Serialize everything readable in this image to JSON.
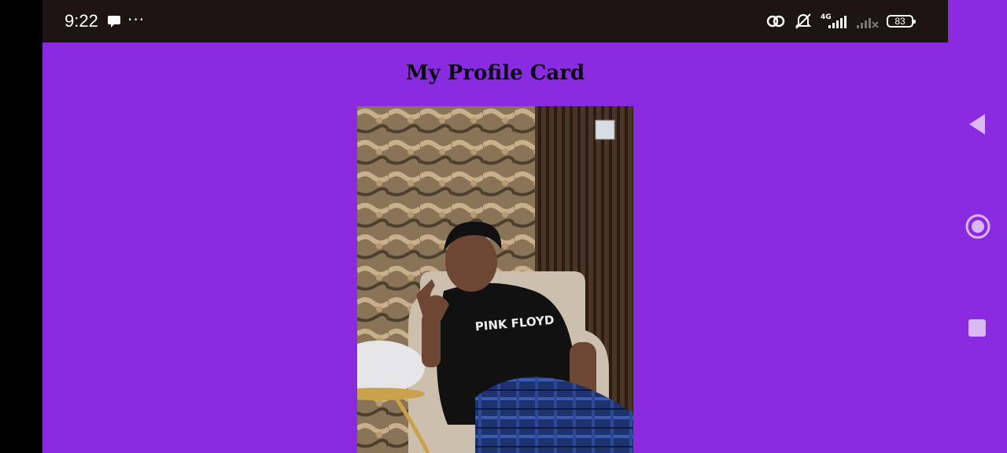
{
  "status_bar": {
    "time": "9:22",
    "network_label": "4G",
    "battery_level": "83",
    "icons": [
      "chat-bubble-icon",
      "more-dots-icon",
      "link-icon",
      "mute-icon",
      "signal-4g-icon",
      "signal-no-service-icon",
      "battery-icon"
    ]
  },
  "app": {
    "title": "My Profile Card",
    "photo": {
      "shirt_text": "PINK FLOYD"
    }
  },
  "nav_bar": {
    "icons": [
      "back-icon",
      "home-icon",
      "recents-icon"
    ]
  },
  "colors": {
    "background": "#8a2be2",
    "status_bar": "#1d1414",
    "title": "#0a0a14",
    "nav_icon": "#d9b8f6"
  }
}
